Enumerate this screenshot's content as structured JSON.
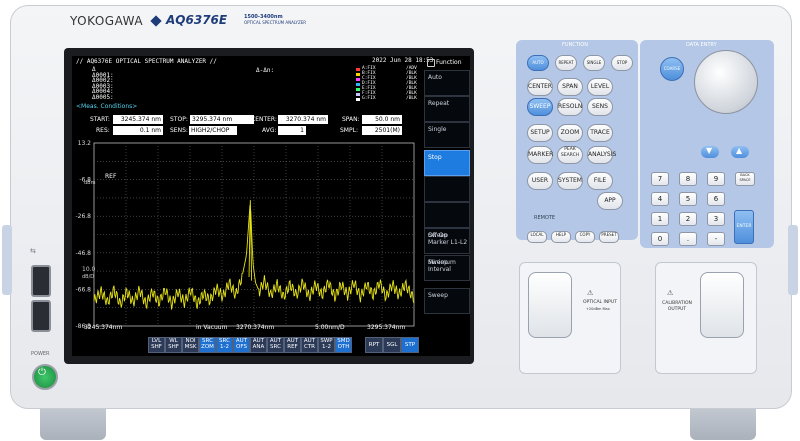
{
  "brand": "YOKOGAWA",
  "model": "AQ6376E",
  "model_sub1": "1500-3400nm",
  "model_sub2": "OPTICAL SPECTRUM ANALYZER",
  "screen": {
    "title": "// AQ6376E OPTICAL SPECTRUM ANALYZER //",
    "datetime": "2022 Jun 28 18:53",
    "markers_left": [
      "Δ",
      "Δ0001:",
      "Δ0002:",
      "Δ0003:",
      "Δ0004:",
      "Δ0005:"
    ],
    "delta_label": "Δ-Δn:",
    "traces": [
      {
        "id": "A:FIX",
        "mode": "/ADV",
        "color": "#ff3b3b"
      },
      {
        "id": "B:FIX",
        "mode": "/BLK",
        "color": "#ffd400"
      },
      {
        "id": "C:FIX",
        "mode": "/BLK",
        "color": "#ff44ff"
      },
      {
        "id": "D:FIX",
        "mode": "/BLK",
        "color": "#2fb6ff"
      },
      {
        "id": "E:FIX",
        "mode": "/BLK",
        "color": "#3cff6a"
      },
      {
        "id": "F:FIX",
        "mode": "/BLK",
        "color": "#c9c9ff"
      },
      {
        "id": "G:FIX",
        "mode": "/BLK",
        "color": "#ffffff"
      }
    ],
    "meas_conditions": "<Meas. Conditions>",
    "start_label": "START:",
    "start_value": "3245.374 nm",
    "stop_label": "STOP:",
    "stop_value": "3295.374 nm",
    "center_label": "CENTER:",
    "center_value": "3270.374 nm",
    "span_label": "SPAN:",
    "span_value": "50.0 nm",
    "res_label": "RES:",
    "res_value": "0.1 nm",
    "sens_label": "SENS:",
    "sens_value": "HIGH2/CHOP",
    "avg_label": "AVG:",
    "avg_value": "1",
    "smpl_label": "SMPL:",
    "smpl_value": "2501(M)",
    "y_ticks": [
      "13.2",
      "-6.8",
      "-26.8",
      "-46.8",
      "-66.8",
      "-86.8"
    ],
    "ref_label": "REF",
    "unit_label": "dBm",
    "div_value": "10.0",
    "div_unit": "dB/D",
    "x_left": "3245.374nm",
    "x_mid_prefix": "in Vacuum",
    "x_mid": "3270.374nm",
    "x_div": "5.00nm/D",
    "x_right": "3295.374nm",
    "function_header": "Function",
    "function_buttons": [
      {
        "label": "Auto",
        "sub": ""
      },
      {
        "label": "Repeat",
        "sub": ""
      },
      {
        "label": "Single",
        "sub": ""
      },
      {
        "label": "Stop",
        "sub": "",
        "active": true
      },
      {
        "label": "",
        "sub": ""
      },
      {
        "label": "",
        "sub": ""
      },
      {
        "label": "Sweep Marker L1-L2",
        "sub": "Off On"
      },
      {
        "label": "Sweep Interval",
        "sub": "Minimum"
      },
      {
        "label": "Sweep",
        "sub": ""
      }
    ],
    "softkeys": [
      {
        "l1": "LVL",
        "l2": "SHF",
        "on": false
      },
      {
        "l1": "WL",
        "l2": "SHF",
        "on": false
      },
      {
        "l1": "NOI",
        "l2": "MSK",
        "on": false
      },
      {
        "l1": "SRC",
        "l2": "ZOM",
        "on": true
      },
      {
        "l1": "SRC",
        "l2": "1-2",
        "on": true
      },
      {
        "l1": "AUT",
        "l2": "OFS",
        "on": true
      },
      {
        "l1": "AUT",
        "l2": "ANA",
        "on": false
      },
      {
        "l1": "AUT",
        "l2": "SRC",
        "on": false
      },
      {
        "l1": "AUT",
        "l2": "REF",
        "on": false
      },
      {
        "l1": "AUT",
        "l2": "CTR",
        "on": false
      },
      {
        "l1": "SWP",
        "l2": "1-2",
        "on": false
      },
      {
        "l1": "SMD",
        "l2": "OTH",
        "on": true
      }
    ],
    "sweep_modes": [
      {
        "label": "RPT",
        "on": false
      },
      {
        "label": "SGL",
        "on": false
      },
      {
        "label": "STP",
        "on": true
      }
    ]
  },
  "function_panel": {
    "header": "FUNCTION",
    "row1": [
      "AUTO",
      "REPEAT",
      "SINGLE",
      "STOP"
    ],
    "row2": [
      "CENTER",
      "SPAN",
      "LEVEL"
    ],
    "row3": [
      "SWEEP",
      "RESOLN",
      "SENS"
    ],
    "row4": [
      "SETUP",
      "ZOOM",
      "TRACE"
    ],
    "row5": [
      "MARKER",
      "PEAK SEARCH",
      "ANALYSIS"
    ],
    "row6": [
      "USER",
      "SYSTEM",
      "FILE"
    ],
    "row7": [
      "APP"
    ],
    "remote_header": "REMOTE",
    "small_keys": [
      "LOCAL",
      "HELP",
      "COPY",
      "PRESET"
    ]
  },
  "data_entry": {
    "header": "DATA ENTRY",
    "coarse": "COARSE",
    "keypad": [
      "7",
      "8",
      "9",
      "4",
      "5",
      "6",
      "1",
      "2",
      "3",
      "0",
      ".",
      "-"
    ],
    "bksp": "BACK SPACE",
    "enter": "ENTER"
  },
  "ports": {
    "optical_input": "OPTICAL INPUT",
    "optical_input_sub": "+20dBm Max",
    "calibration_output": "CALIBRATION OUTPUT"
  },
  "power_label": "POWER",
  "chart_data": {
    "type": "line",
    "xlabel": "",
    "ylabel": "dBm",
    "xlim": [
      3245.374,
      3295.374
    ],
    "ylim": [
      -86.8,
      13.2
    ],
    "grid": true,
    "series": [
      {
        "x": [
          3245.374,
          3246.5,
          3247.5,
          3248.5,
          3249.5,
          3250.5,
          3251.5,
          3252.5,
          3253.5,
          3254.5,
          3255.5,
          3256.5,
          3257.5,
          3258.5,
          3259.5,
          3260.5,
          3261.5,
          3262.5,
          3263.5,
          3264.5,
          3265.5,
          3266.5,
          3267.5,
          3268.5,
          3269.2,
          3269.8,
          3270.2,
          3270.6,
          3271.2,
          3272,
          3273,
          3274,
          3275,
          3276,
          3277,
          3278,
          3279,
          3280,
          3281,
          3282,
          3283,
          3284,
          3285,
          3286,
          3287,
          3288,
          3289,
          3290,
          3291,
          3292,
          3293,
          3294,
          3295.374
        ],
        "y": [
          -73,
          -68,
          -74,
          -67,
          -75,
          -68,
          -74,
          -67,
          -75,
          -68,
          -74,
          -67,
          -75,
          -68,
          -74,
          -67,
          -75,
          -69,
          -73,
          -66,
          -71,
          -63,
          -70,
          -60,
          -48,
          -18,
          -52,
          -63,
          -68,
          -62,
          -70,
          -64,
          -71,
          -64,
          -70,
          -63,
          -71,
          -64,
          -70,
          -63,
          -71,
          -64,
          -70,
          -63,
          -71,
          -64,
          -70,
          -63,
          -71,
          -64,
          -70,
          -64,
          -72
        ]
      }
    ]
  }
}
